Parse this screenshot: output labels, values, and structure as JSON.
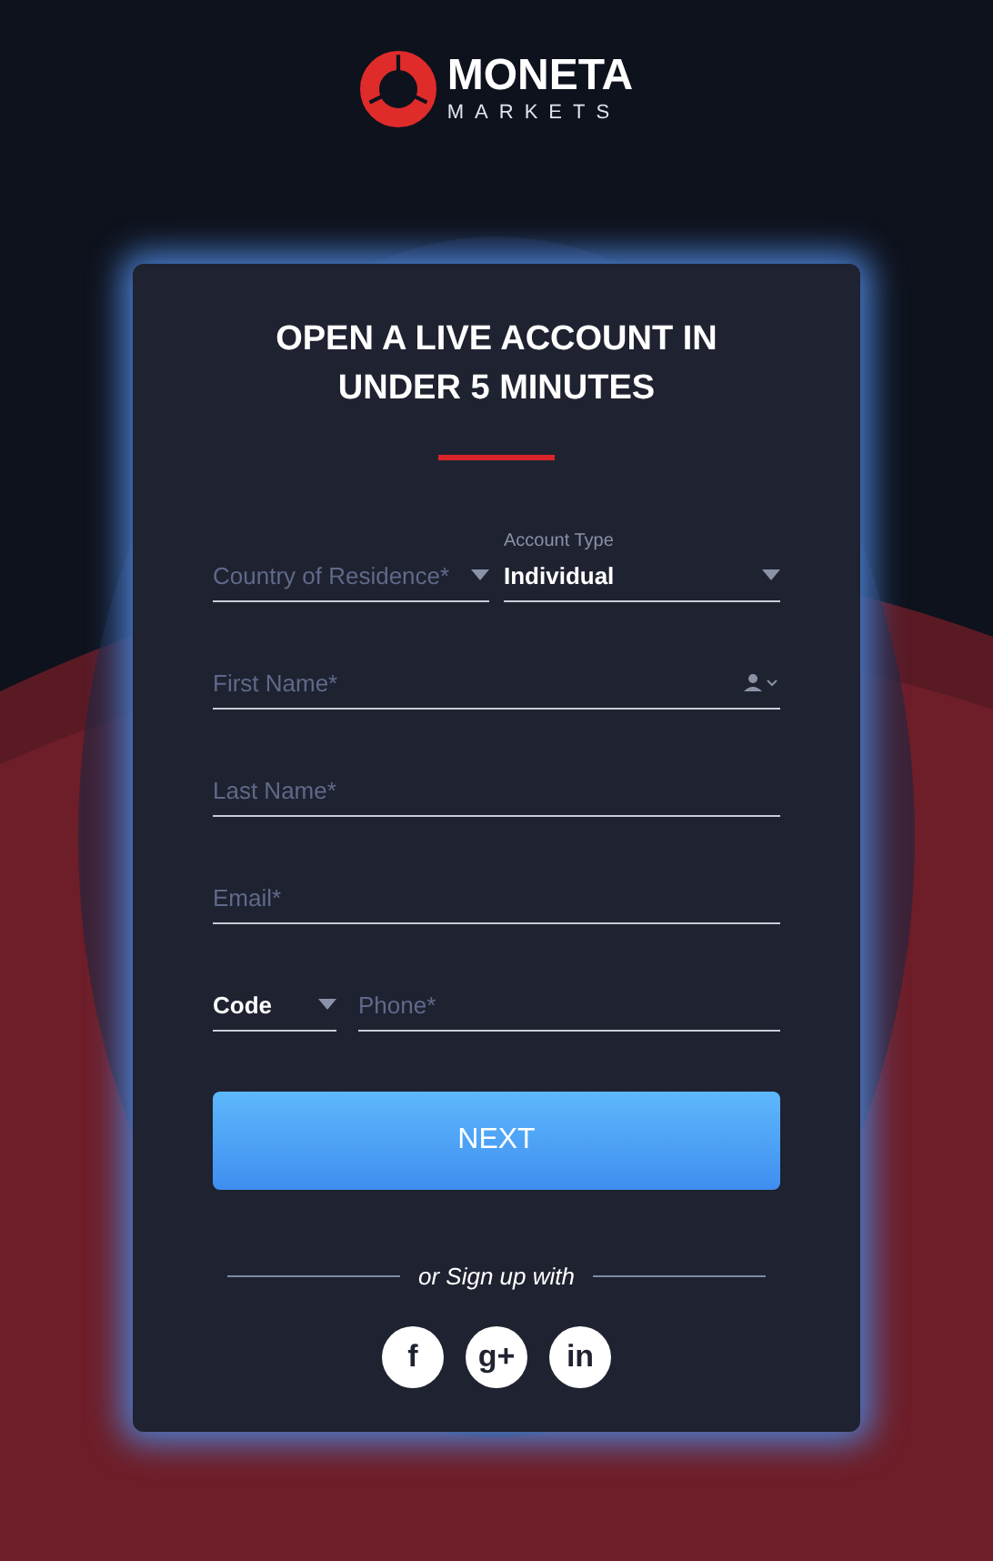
{
  "brand": {
    "name": "MONETA",
    "tagline": "MARKETS"
  },
  "heading": [
    "OPEN A LIVE ACCOUNT IN",
    "UNDER 5 MINUTES"
  ],
  "rows": [
    {
      "fields": [
        {
          "kind": "select",
          "placeholder": "Country of Residence*"
        },
        {
          "kind": "select",
          "label": "Account Type",
          "value": "Individual"
        }
      ]
    },
    {
      "fields": [
        {
          "kind": "person",
          "placeholder": "First Name*"
        }
      ]
    },
    {
      "fields": [
        {
          "kind": "text",
          "placeholder": "Last Name*"
        }
      ]
    },
    {
      "fields": [
        {
          "kind": "text",
          "placeholder": "Email*"
        }
      ]
    },
    {
      "fields": [
        {
          "kind": "select",
          "value": "Code"
        },
        {
          "kind": "text",
          "placeholder": "Phone*"
        }
      ]
    }
  ],
  "next_button": "NEXT",
  "divider_text": "or Sign up with",
  "social": [
    {
      "glyph": "f"
    },
    {
      "glyph": "g+"
    },
    {
      "glyph": "in"
    }
  ]
}
